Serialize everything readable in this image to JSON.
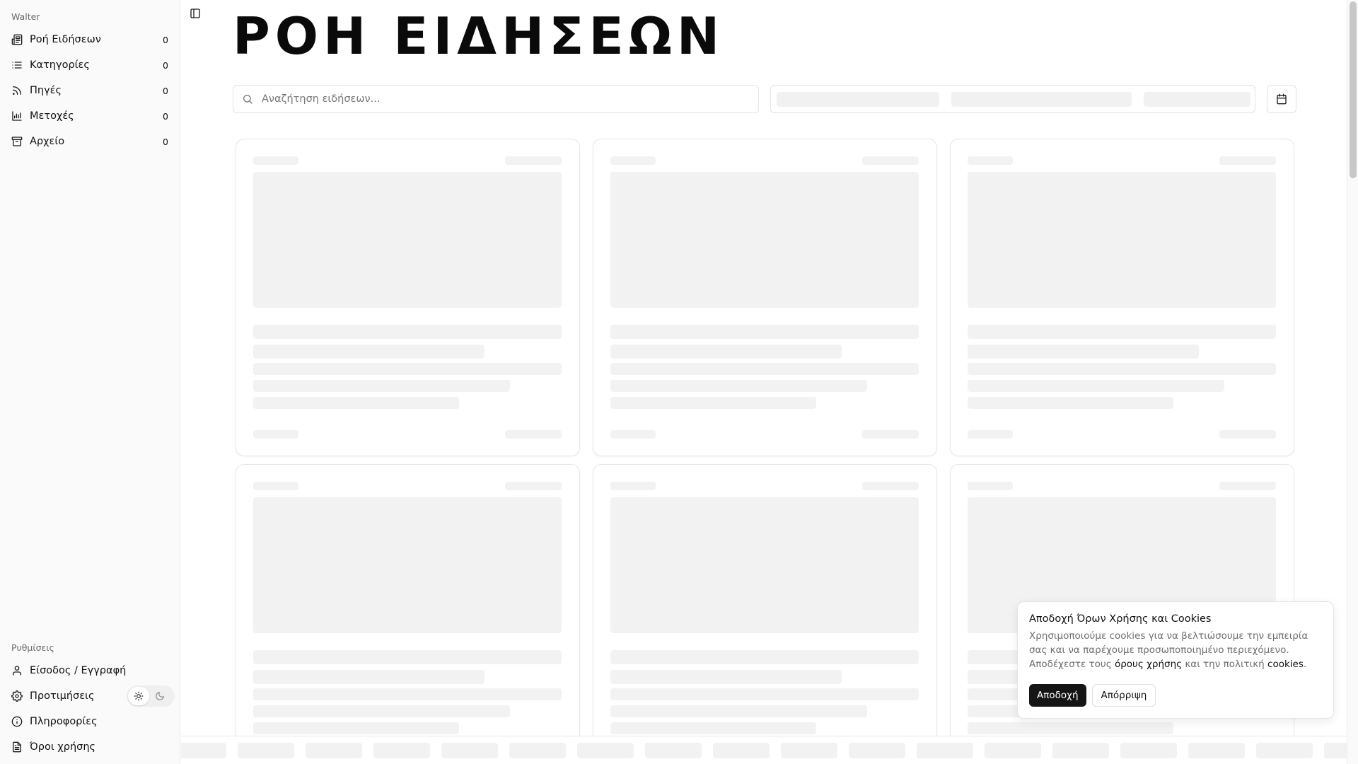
{
  "sidebar": {
    "brand": "Walter",
    "nav": [
      {
        "label": "Ροή Ειδήσεων",
        "count": "0",
        "icon": "newspaper-icon"
      },
      {
        "label": "Κατηγορίες",
        "count": "0",
        "icon": "list-icon"
      },
      {
        "label": "Πηγές",
        "count": "0",
        "icon": "rss-icon"
      },
      {
        "label": "Μετοχές",
        "count": "0",
        "icon": "chart-icon"
      },
      {
        "label": "Αρχείο",
        "count": "0",
        "icon": "archive-icon"
      }
    ],
    "settings_label": "Ρυθμίσεις",
    "settings": [
      {
        "label": "Είσοδος / Εγγραφή",
        "icon": "user-icon"
      },
      {
        "label": "Προτιμήσεις",
        "icon": "gear-icon"
      },
      {
        "label": "Πληροφορίες",
        "icon": "info-icon"
      },
      {
        "label": "Όροι χρήσης",
        "icon": "document-icon"
      }
    ],
    "theme": {
      "active": "light",
      "options": [
        "sun-icon",
        "moon-icon"
      ]
    }
  },
  "main": {
    "title": "ΡΟΗ ΕΙΔΗΣΕΩΝ",
    "search_placeholder": "Αναζήτηση ειδήσεων...",
    "state": "loading"
  },
  "cookie": {
    "title": "Αποδοχή Όρων Χρήσης και Cookies",
    "text": "Χρησιμοποιούμε cookies για να βελτιώσουμε την εμπειρία σας και να παρέχουμε προσωποποιημένο περιεχόμενο. Αποδέχεστε τους ",
    "terms_link": "όρους χρήσης",
    "middle": " και την πολιτική ",
    "cookies_link": "cookies",
    "end": ".",
    "accept": "Αποδοχή",
    "reject": "Απόρριψη"
  },
  "colors": {
    "accent": "#151515",
    "skeleton": "#f2f2f2",
    "sidebar_bg": "#fafafa"
  }
}
